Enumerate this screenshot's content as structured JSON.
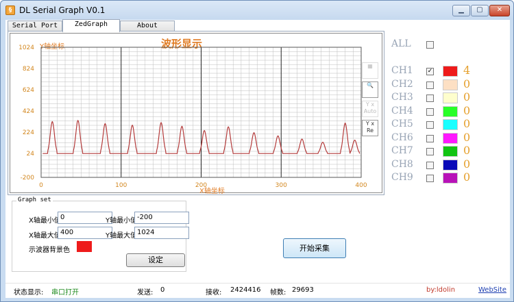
{
  "window": {
    "title": "DL Serial Graph V0.1",
    "icon": "app-icon"
  },
  "tabs": [
    {
      "label": "Serial Port"
    },
    {
      "label": "ZedGraph"
    },
    {
      "label": "About"
    }
  ],
  "graph": {
    "title": "波形显示",
    "xlabel": "X轴坐标",
    "ylabel": "Y轴坐标",
    "grid_color": "#bdbdbd",
    "major_grid_color": "#222222",
    "line_color": "#b33a3a",
    "tool_buttons": [
      {
        "name": "grid-toggle-icon",
        "label": ""
      },
      {
        "name": "zoom-icon",
        "label": ""
      },
      {
        "name": "auto-scale-icon",
        "label": "Y x Auto"
      },
      {
        "name": "reset-icon",
        "label": "Y x Re"
      }
    ]
  },
  "chart_data": {
    "type": "line",
    "title": "波形显示",
    "xlabel": "X轴坐标",
    "ylabel": "Y轴坐标",
    "xlim": [
      0,
      400
    ],
    "ylim": [
      -200,
      1024
    ],
    "x_ticks": [
      "0",
      "100",
      "200",
      "300",
      "400"
    ],
    "y_ticks": [
      "1024",
      "824",
      "624",
      "424",
      "224",
      "24",
      "-200"
    ],
    "grid": true,
    "peaks": [
      {
        "x": 14,
        "y": 324
      },
      {
        "x": 46,
        "y": 335
      },
      {
        "x": 80,
        "y": 305
      },
      {
        "x": 114,
        "y": 290
      },
      {
        "x": 150,
        "y": 315
      },
      {
        "x": 176,
        "y": 280
      },
      {
        "x": 204,
        "y": 240
      },
      {
        "x": 234,
        "y": 275
      },
      {
        "x": 266,
        "y": 220
      },
      {
        "x": 296,
        "y": 190
      },
      {
        "x": 326,
        "y": 160
      },
      {
        "x": 352,
        "y": 130
      },
      {
        "x": 380,
        "y": 310
      },
      {
        "x": 392,
        "y": 150
      }
    ],
    "baseline": 24,
    "series": [
      {
        "name": "CH1"
      }
    ]
  },
  "channels": {
    "all_label": "ALL",
    "all_checked": false,
    "items": [
      {
        "label": "CH1",
        "checked": true,
        "color": "#ee1b1b",
        "value": "4"
      },
      {
        "label": "CH2",
        "checked": false,
        "color": "#fde0c4",
        "value": "0"
      },
      {
        "label": "CH3",
        "checked": false,
        "color": "#fefecd",
        "value": "0"
      },
      {
        "label": "CH4",
        "checked": false,
        "color": "#28ff28",
        "value": "0"
      },
      {
        "label": "CH5",
        "checked": false,
        "color": "#19ffff",
        "value": "0"
      },
      {
        "label": "CH6",
        "checked": false,
        "color": "#ff18ff",
        "value": "0"
      },
      {
        "label": "CH7",
        "checked": false,
        "color": "#12c412",
        "value": "0"
      },
      {
        "label": "CH8",
        "checked": false,
        "color": "#0a0ab8",
        "value": "0"
      },
      {
        "label": "CH9",
        "checked": false,
        "color": "#b812b8",
        "value": "0"
      }
    ]
  },
  "graph_set": {
    "title": "Graph set",
    "x_min_label": "X轴最小值",
    "x_min_value": "0",
    "y_min_label": "Y轴最小值",
    "y_min_value": "-200",
    "x_max_label": "X轴最大值",
    "x_max_value": "400",
    "y_max_label": "Y轴最大值",
    "y_max_value": "1024",
    "bg_color_label": "示波器背景色",
    "bg_color": "#ee1b1b",
    "set_button": "设定"
  },
  "start_button": "开始采集",
  "status": {
    "label": "状态显示:",
    "state": "串口打开",
    "send_label": "发送:",
    "send_value": "0",
    "recv_label": "接收:",
    "recv_value": "2424416",
    "frames_label": "帧数:",
    "frames_value": "29693",
    "author": "by:ldolin",
    "website": "WebSite"
  }
}
